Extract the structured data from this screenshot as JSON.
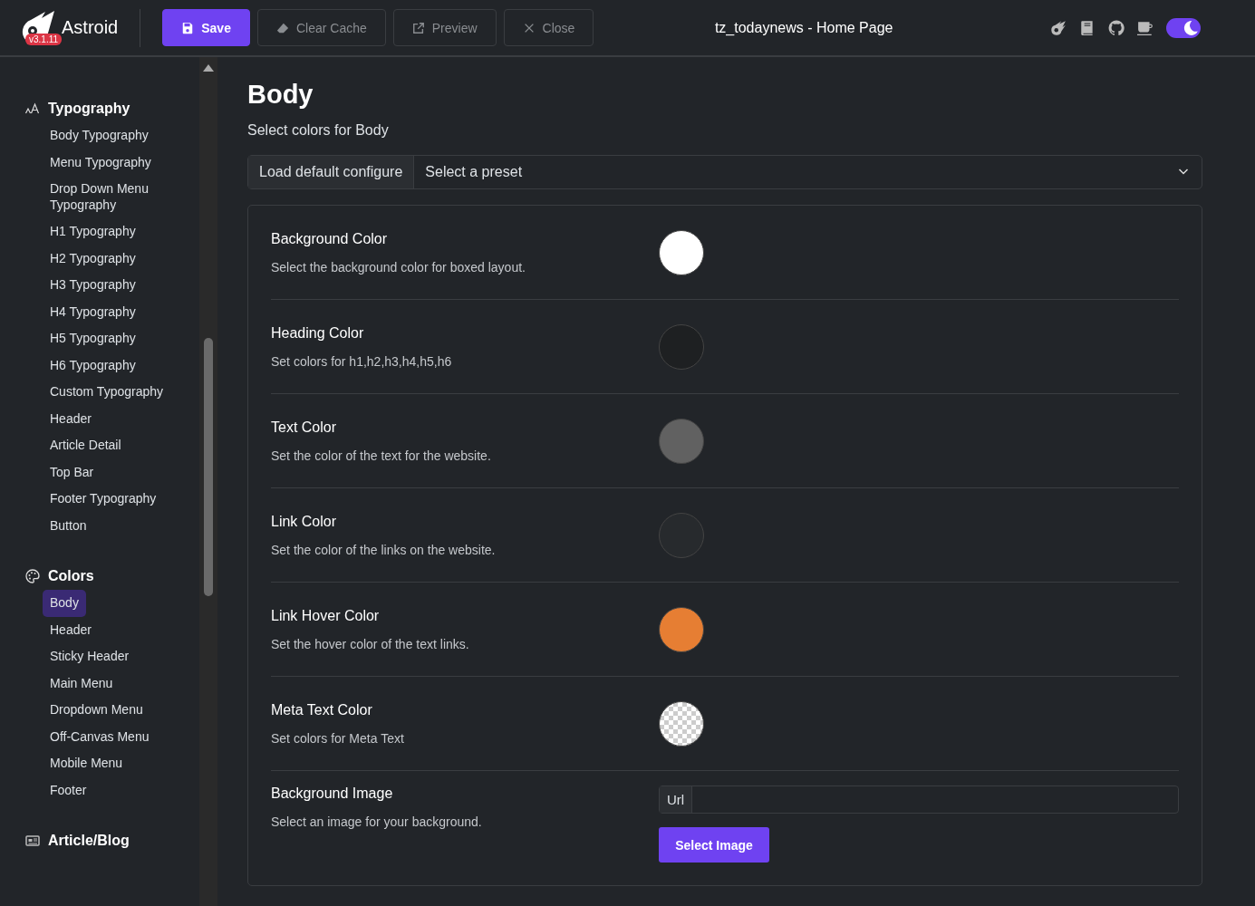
{
  "header": {
    "app_name": "Astroid",
    "version": "v3.1.11",
    "buttons": [
      {
        "label": "Save",
        "kind": "primary"
      },
      {
        "label": "Clear Cache",
        "kind": "outline"
      },
      {
        "label": "Preview",
        "kind": "outline"
      },
      {
        "label": "Close",
        "kind": "outline"
      }
    ],
    "page_title": "tz_todaynews - Home Page",
    "dark_mode": {
      "on": true
    }
  },
  "sidebar": {
    "groups": [
      {
        "title": "Typography",
        "items": [
          {
            "label": "Body Typography",
            "selected": false
          },
          {
            "label": "Menu Typography",
            "selected": false
          },
          {
            "label": "Drop Down Menu Typography",
            "selected": false
          },
          {
            "label": "H1 Typography",
            "selected": false
          },
          {
            "label": "H2 Typography",
            "selected": false
          },
          {
            "label": "H3 Typography",
            "selected": false
          },
          {
            "label": "H4 Typography",
            "selected": false
          },
          {
            "label": "H5 Typography",
            "selected": false
          },
          {
            "label": "H6 Typography",
            "selected": false
          },
          {
            "label": "Custom Typography",
            "selected": false
          },
          {
            "label": "Header",
            "selected": false
          },
          {
            "label": "Article Detail",
            "selected": false
          },
          {
            "label": "Top Bar",
            "selected": false
          },
          {
            "label": "Footer Typography",
            "selected": false
          },
          {
            "label": "Button",
            "selected": false
          }
        ]
      },
      {
        "title": "Colors",
        "items": [
          {
            "label": "Body",
            "selected": true
          },
          {
            "label": "Header",
            "selected": false
          },
          {
            "label": "Sticky Header",
            "selected": false
          },
          {
            "label": "Main Menu",
            "selected": false
          },
          {
            "label": "Dropdown Menu",
            "selected": false
          },
          {
            "label": "Off-Canvas Menu",
            "selected": false
          },
          {
            "label": "Mobile Menu",
            "selected": false
          },
          {
            "label": "Footer",
            "selected": false
          }
        ]
      },
      {
        "title": "Article/Blog"
      }
    ]
  },
  "main": {
    "title": "Body",
    "subtitle": "Select colors for Body",
    "preset": {
      "button": "Load default configure",
      "placeholder": "Select a preset"
    },
    "fields": [
      {
        "kind": "color",
        "label": "Background Color",
        "description": "Select the background color for boxed layout.",
        "color": "#ffffff"
      },
      {
        "kind": "color",
        "label": "Heading Color",
        "description": "Set colors for h1,h2,h3,h4,h5,h6",
        "color": "#1e2022"
      },
      {
        "kind": "color",
        "label": "Text Color",
        "description": "Set the color of the text for the website.",
        "color": "#616161"
      },
      {
        "kind": "color",
        "label": "Link Color",
        "description": "Set the color of the links on the website.",
        "color": "#272a2d"
      },
      {
        "kind": "color",
        "label": "Link Hover Color",
        "description": "Set the hover color of the text links.",
        "color": "#e67e33"
      },
      {
        "kind": "transparent",
        "label": "Meta Text Color",
        "description": "Set colors for Meta Text"
      },
      {
        "kind": "image",
        "label": "Background Image",
        "description": "Select an image for your background.",
        "addon": "Url",
        "button": "Select Image"
      }
    ]
  }
}
